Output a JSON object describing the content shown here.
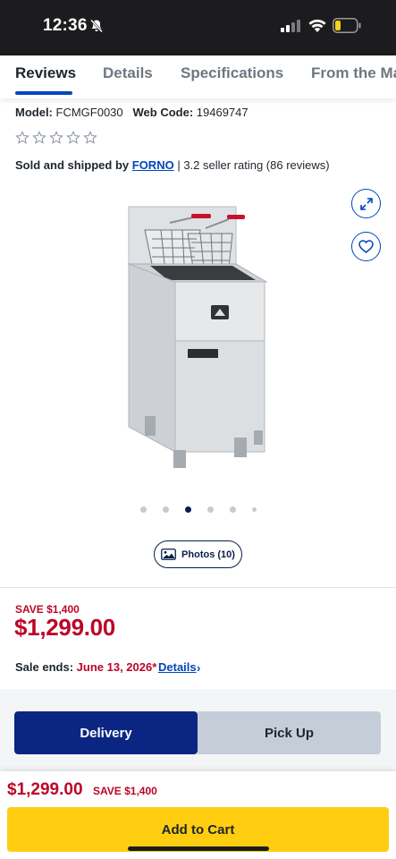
{
  "status_bar": {
    "time": "12:36"
  },
  "tabs": [
    {
      "label": "Reviews",
      "active": true
    },
    {
      "label": "Details",
      "active": false
    },
    {
      "label": "Specifications",
      "active": false
    },
    {
      "label": "From the Ma",
      "active": false
    }
  ],
  "product": {
    "model_label": "Model:",
    "model_value": "FCMGF0030",
    "webcode_label": "Web Code:",
    "webcode_value": "19469747",
    "rating_stars": 0,
    "sold_by_label": "Sold and shipped by",
    "seller": "FORNO",
    "seller_rating": "| 3.2 seller rating (86 reviews)",
    "image_icon": "deep-fryer-image",
    "carousel_count": 6,
    "carousel_active_index": 2
  },
  "photos_button": {
    "label": "Photos (10)"
  },
  "pricing": {
    "save_label": "SAVE $1,400",
    "price": "$1,299.00",
    "sale_ends_label": "Sale ends:",
    "sale_ends_date": "June 13, 2026*",
    "details_link": "Details"
  },
  "fulfillment": {
    "delivery_label": "Delivery",
    "pickup_label": "Pick Up",
    "selected": "Delivery"
  },
  "sticky_bar": {
    "price": "$1,299.00",
    "save_label": "SAVE $1,400",
    "add_to_cart_label": "Add to Cart"
  },
  "colors": {
    "accent_blue": "#0046be",
    "navy": "#0a2682",
    "sale_red": "#bb0628",
    "cart_yellow": "#ffce11"
  }
}
